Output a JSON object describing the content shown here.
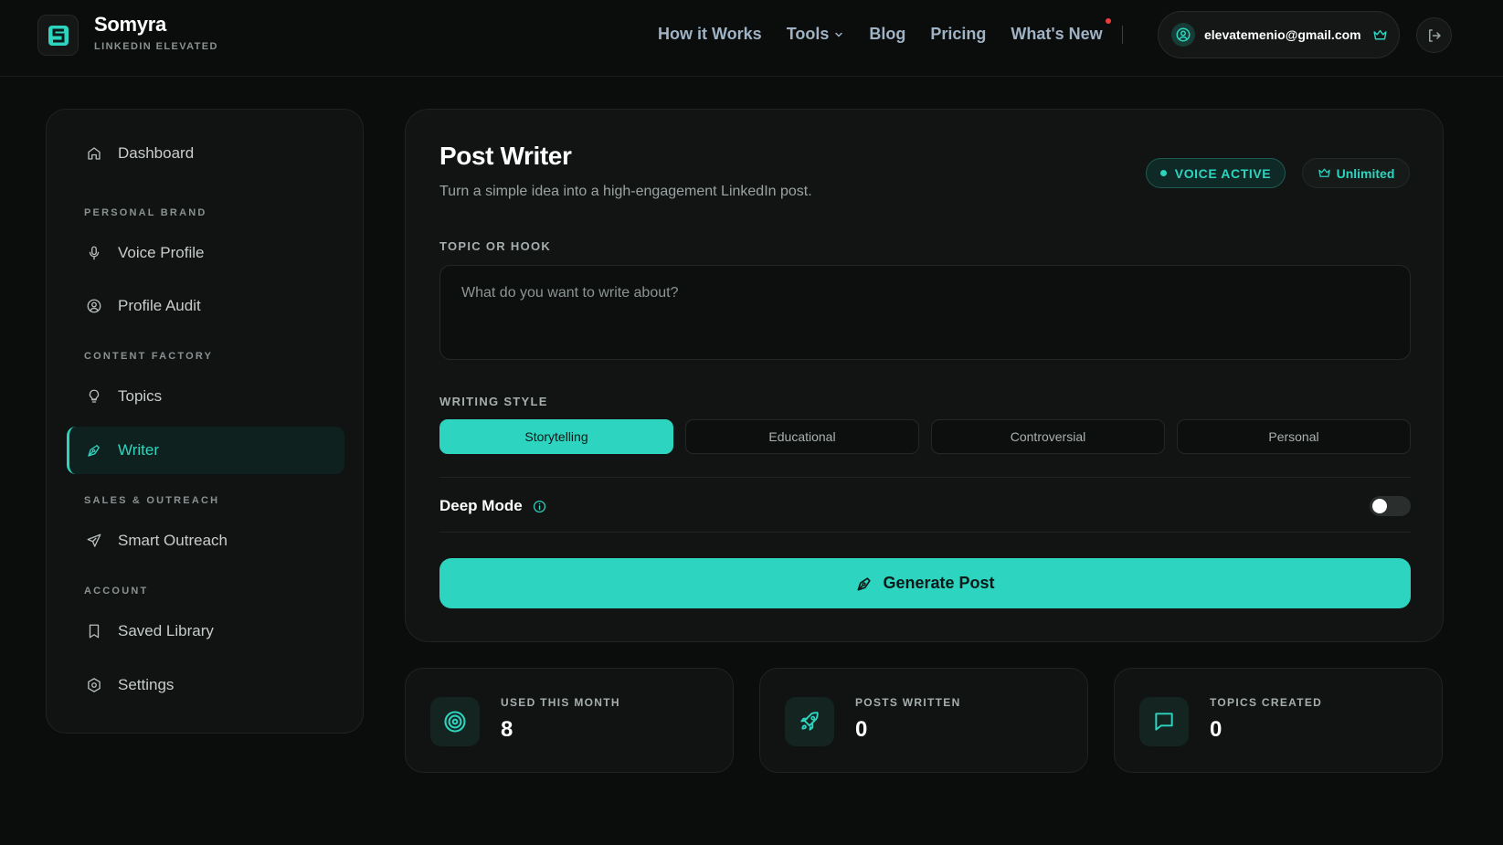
{
  "brand": {
    "name": "Somyra",
    "tagline": "LINKEDIN ELEVATED"
  },
  "nav": {
    "how_it_works": "How it Works",
    "tools": "Tools",
    "blog": "Blog",
    "pricing": "Pricing",
    "whats_new": "What's New"
  },
  "user": {
    "email": "elevatemenio@gmail.com"
  },
  "sidebar": {
    "dashboard": "Dashboard",
    "sections": {
      "personal_brand": "PERSONAL BRAND",
      "content_factory": "CONTENT FACTORY",
      "sales_outreach": "SALES & OUTREACH",
      "account": "ACCOUNT"
    },
    "voice_profile": "Voice Profile",
    "profile_audit": "Profile Audit",
    "topics": "Topics",
    "writer": "Writer",
    "smart_outreach": "Smart Outreach",
    "saved_library": "Saved Library",
    "settings": "Settings"
  },
  "main": {
    "title": "Post Writer",
    "subtitle": "Turn a simple idea into a high-engagement LinkedIn post.",
    "voice_badge": "VOICE ACTIVE",
    "plan_badge": "Unlimited",
    "topic_label": "TOPIC OR HOOK",
    "topic_placeholder": "What do you want to write about?",
    "topic_value": "",
    "style_label": "WRITING STYLE",
    "styles": [
      "Storytelling",
      "Educational",
      "Controversial",
      "Personal"
    ],
    "selected_style": "Storytelling",
    "deep_mode_label": "Deep Mode",
    "deep_mode_enabled": false,
    "generate_label": "Generate Post"
  },
  "stats": [
    {
      "label": "USED THIS MONTH",
      "value": "8",
      "icon": "target-icon"
    },
    {
      "label": "POSTS WRITTEN",
      "value": "0",
      "icon": "rocket-icon"
    },
    {
      "label": "TOPICS CREATED",
      "value": "0",
      "icon": "message-icon"
    }
  ],
  "colors": {
    "accent": "#2dd4bf",
    "background": "#0b0c0c",
    "card": "#121414",
    "nav_link": "#9fb3c4",
    "notification_dot": "#ef3b3b"
  }
}
